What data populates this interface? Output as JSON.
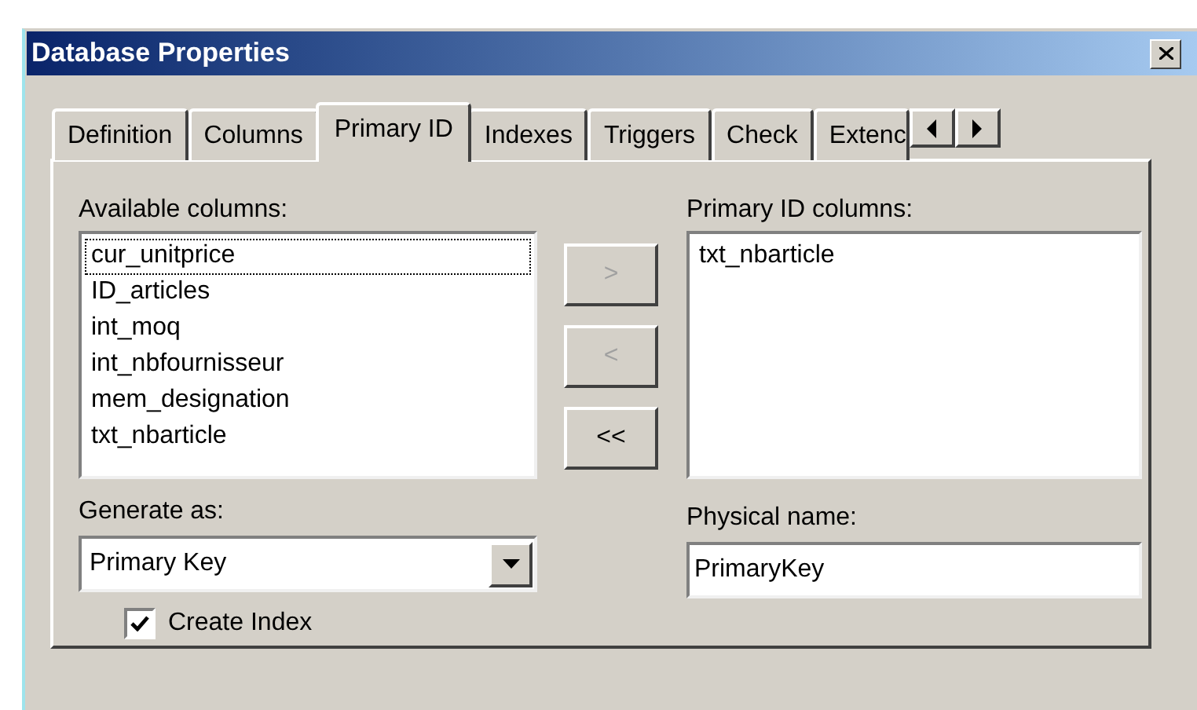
{
  "window": {
    "title": "Database Properties"
  },
  "tabs": [
    {
      "label": "Definition",
      "selected": false
    },
    {
      "label": "Columns",
      "selected": false
    },
    {
      "label": "Primary ID",
      "selected": true
    },
    {
      "label": "Indexes",
      "selected": false
    },
    {
      "label": "Triggers",
      "selected": false
    },
    {
      "label": "Check",
      "selected": false
    },
    {
      "label": "Extenc",
      "selected": false
    }
  ],
  "available_columns": {
    "label": "Available columns:",
    "items": [
      {
        "text": "cur_unitprice",
        "focused": true
      },
      {
        "text": "ID_articles",
        "focused": false
      },
      {
        "text": "int_moq",
        "focused": false
      },
      {
        "text": "int_nbfournisseur",
        "focused": false
      },
      {
        "text": "mem_designation",
        "focused": false
      },
      {
        "text": "txt_nbarticle",
        "focused": false
      }
    ]
  },
  "move_buttons": [
    {
      "label": ">",
      "disabled": true
    },
    {
      "label": "<",
      "disabled": true
    },
    {
      "label": "<<",
      "disabled": false
    }
  ],
  "primary_id_columns": {
    "label": "Primary ID columns:",
    "items": [
      {
        "text": "txt_nbarticle",
        "focused": false
      }
    ]
  },
  "generate_as": {
    "label": "Generate as:",
    "value": "Primary Key"
  },
  "create_index": {
    "label": "Create Index",
    "checked": true
  },
  "physical_name": {
    "label": "Physical name:",
    "value": "PrimaryKey"
  }
}
